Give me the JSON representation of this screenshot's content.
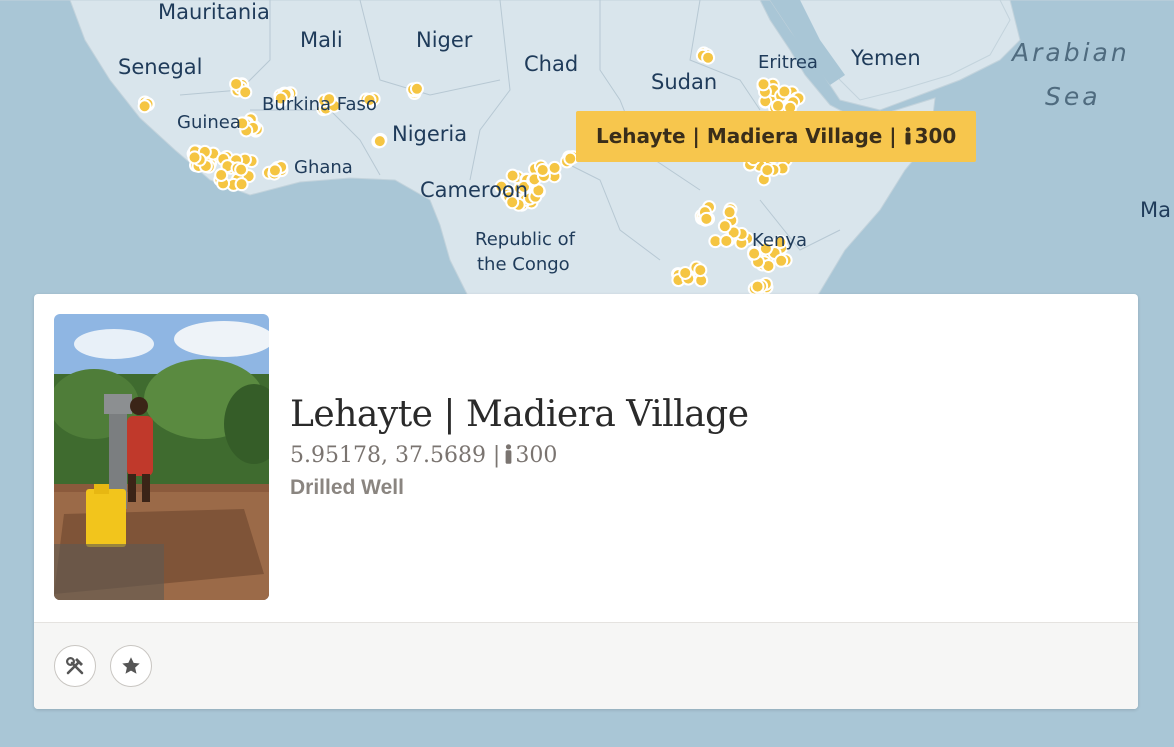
{
  "map": {
    "labels": {
      "mauritania": "Mauritania",
      "mali": "Mali",
      "niger": "Niger",
      "senegal": "Senegal",
      "chad": "Chad",
      "sudan": "Sudan",
      "eritrea": "Eritrea",
      "yemen": "Yemen",
      "arabian": "Arabian",
      "sea": "Sea",
      "guinea": "Guinea",
      "burkina": "Burkina Faso",
      "nigeria": "Nigeria",
      "ghana": "Ghana",
      "cameroon": "Cameroon",
      "republic_of": "Republic of",
      "the_congo": "the Congo",
      "kenya": "Kenya",
      "ma": "Ma"
    },
    "marker_color": "#f5c542",
    "water_color": "#a9c6d6",
    "land_color": "#d9e5ec"
  },
  "tooltip": {
    "name": "Lehayte | Madiera Village |",
    "people": "300"
  },
  "card": {
    "title": "Lehayte | Madiera Village",
    "coords": "5.95178, 37.5689 |",
    "people": "300",
    "type": "Drilled Well",
    "buttons": {
      "tools_icon": "hammer-wrench-icon",
      "favorite_icon": "star-icon"
    }
  }
}
